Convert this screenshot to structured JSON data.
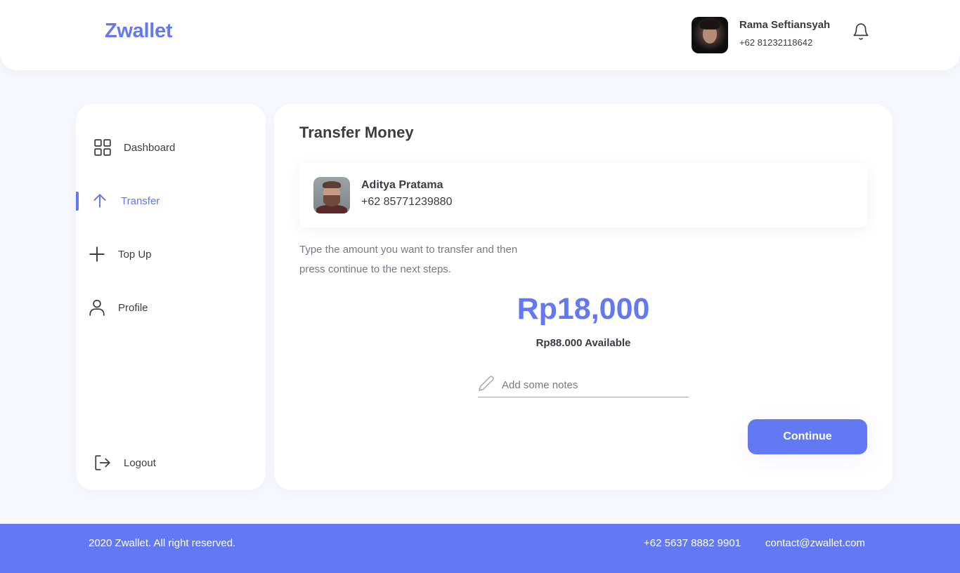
{
  "brand": "Zwallet",
  "user": {
    "name": "Rama Seftiansyah",
    "phone": "+62 81232118642"
  },
  "header": {
    "notification_icon": "bell-icon"
  },
  "sidebar": {
    "items": [
      {
        "label": "Dashboard",
        "icon": "grid-icon",
        "active": false
      },
      {
        "label": "Transfer",
        "icon": "arrow-up-icon",
        "active": true
      },
      {
        "label": "Top Up",
        "icon": "plus-icon",
        "active": false
      },
      {
        "label": "Profile",
        "icon": "user-icon",
        "active": false
      }
    ],
    "logout": {
      "label": "Logout",
      "icon": "logout-icon"
    }
  },
  "main": {
    "title": "Transfer Money",
    "recipient": {
      "name": "Aditya Pratama",
      "phone": "+62 85771239880"
    },
    "instruction_line1": "Type the amount you want to transfer and then",
    "instruction_line2": "press continue to the next steps.",
    "amount": "Rp18,000",
    "available": "Rp88.000 Available",
    "notes": {
      "placeholder": "Add some notes",
      "value": ""
    },
    "continue_label": "Continue"
  },
  "footer": {
    "copyright": "2020 Zwallet. All right reserved.",
    "phone": "+62 5637 8882 9901",
    "email": "contact@zwallet.com"
  },
  "colors": {
    "accent": "#6379f4",
    "text": "#3a3d42",
    "muted": "#7a7886",
    "background": "#f7f8fd"
  }
}
